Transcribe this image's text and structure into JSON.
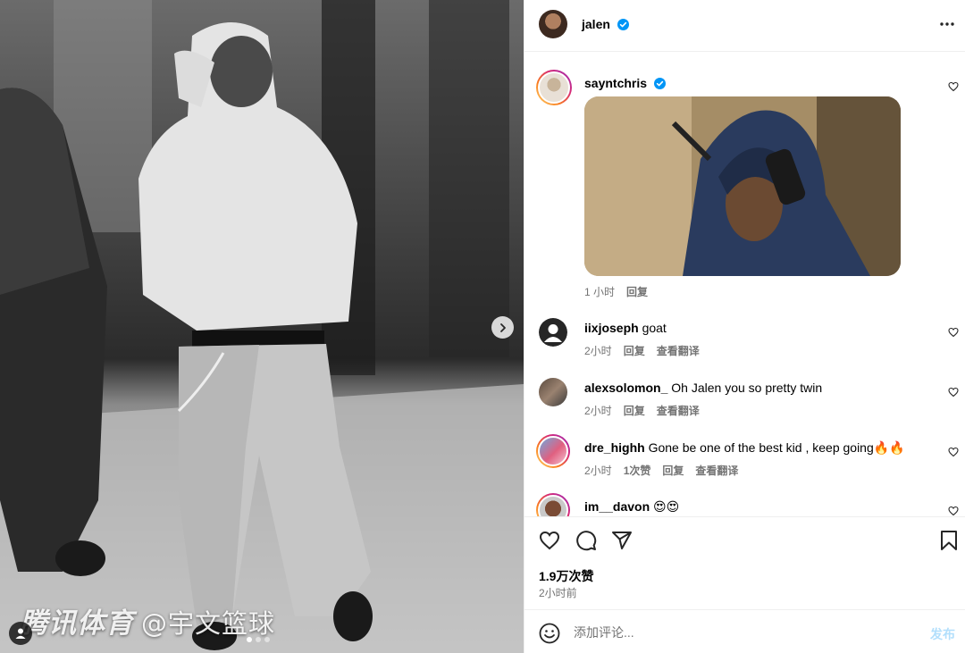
{
  "photo": {
    "watermark_brand": "腾讯体育",
    "watermark_handle": "@宇文篮球",
    "next_icon": "chevron-right-icon",
    "carousel_total": 3,
    "carousel_active": 1
  },
  "post": {
    "author": "jalen",
    "verified": true
  },
  "comments": [
    {
      "user": "sayntchris",
      "verified": true,
      "text": "",
      "has_image": true,
      "time": "1 小时",
      "likes": "",
      "reply": "回复",
      "translate": ""
    },
    {
      "user": "iixjoseph",
      "verified": false,
      "text": "goat",
      "has_image": false,
      "time": "2小时",
      "likes": "",
      "reply": "回复",
      "translate": "查看翻译"
    },
    {
      "user": "alexsolomon_",
      "verified": false,
      "text": "Oh Jalen you so pretty twin",
      "has_image": false,
      "time": "2小时",
      "likes": "",
      "reply": "回复",
      "translate": "查看翻译"
    },
    {
      "user": "dre_highh",
      "verified": false,
      "text": "Gone be one of the best kid , keep going🔥🔥",
      "has_image": false,
      "time": "2小时",
      "likes": "1次赞",
      "reply": "回复",
      "translate": "查看翻译"
    },
    {
      "user": "im__davon",
      "verified": false,
      "text": "😍😍",
      "has_image": false,
      "time": "",
      "likes": "",
      "reply": "",
      "translate": ""
    }
  ],
  "actions": {
    "like_count": "1.9万次赞",
    "posted_time": "2小时前"
  },
  "add_comment": {
    "placeholder": "添加评论...",
    "post_label": "发布"
  },
  "colors": {
    "verified_blue": "#0095f6",
    "muted_text": "#737373",
    "post_button_disabled": "#b2dffc",
    "story_ring_start": "#feda75",
    "story_ring_end": "#d62976"
  }
}
